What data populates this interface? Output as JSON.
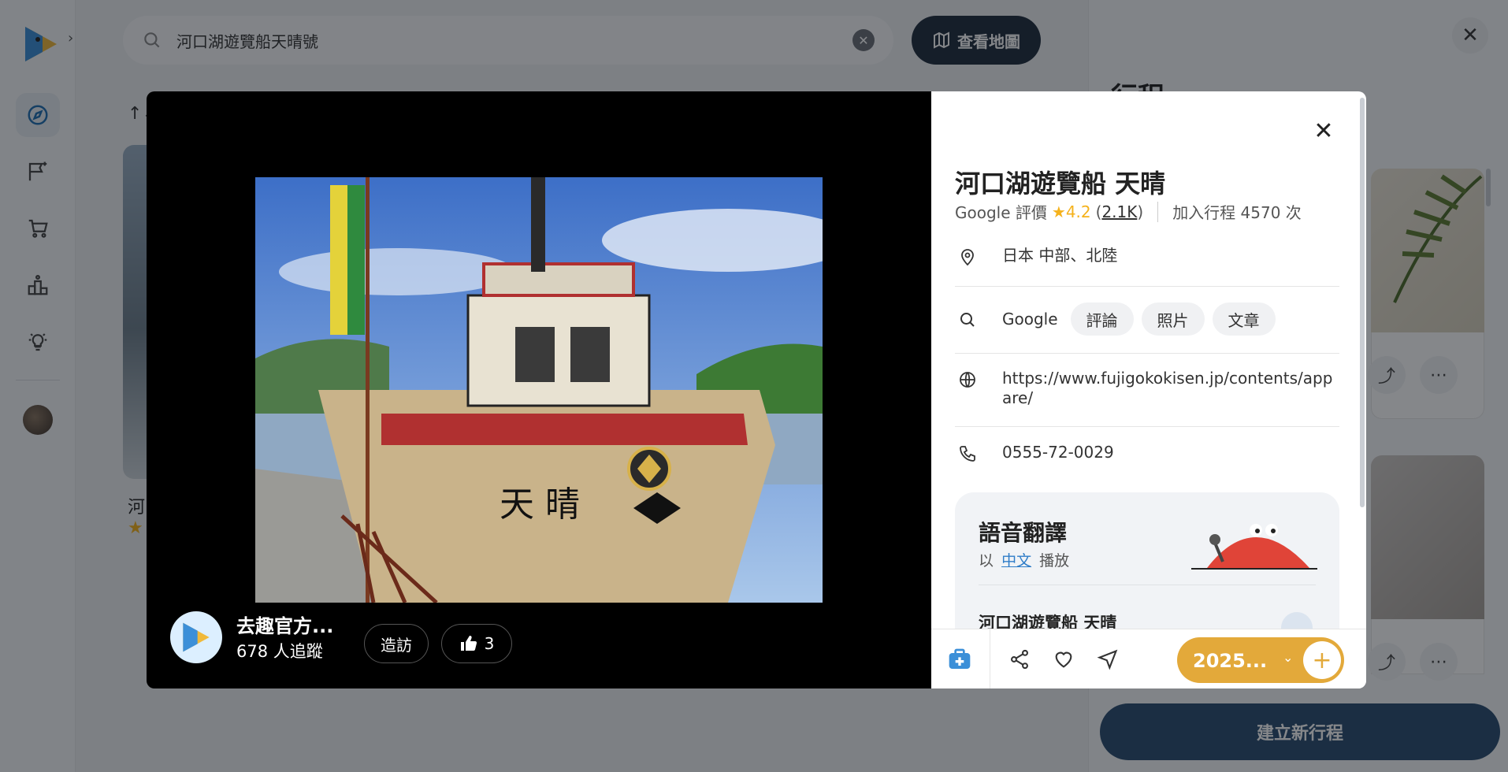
{
  "search": {
    "query": "河口湖遊覽船天晴號",
    "map_button": "查看地圖"
  },
  "background": {
    "card_title": "河",
    "card_star": "★"
  },
  "side_panel": {
    "title": "行程",
    "new_trip_button": "建立新行程"
  },
  "poi": {
    "title": "河口湖遊覽船 天晴",
    "rating_source": "Google 評價",
    "rating_star": "★",
    "rating": "4.2",
    "paren_open": "(",
    "review_count": "2.1K",
    "paren_close": ")",
    "added_to_trips": "加入行程 4570 次",
    "location": "日本 中部、北陸",
    "search_label": "Google",
    "search_chips": [
      "評論",
      "照片",
      "文章"
    ],
    "website": "https://www.fujigokokisen.jp/contents/appare/",
    "phone": "0555-72-0029"
  },
  "voice": {
    "title": "語音翻譯",
    "prefix": "以",
    "language": "中文",
    "suffix": "播放",
    "item_title": "河口湖遊覽船 天晴"
  },
  "author": {
    "name": "去趣官方...",
    "followers": "678 人追蹤"
  },
  "media_actions": {
    "visit": "造訪",
    "likes": "3"
  },
  "trip_selector": {
    "label": "2025..."
  },
  "icons": [
    "search-icon",
    "clear-icon",
    "map-icon",
    "compass-icon",
    "flag-icon",
    "cart-icon",
    "ranking-icon",
    "bulb-icon",
    "close-icon",
    "location-pin-icon",
    "globe-icon",
    "phone-icon",
    "thumbs-up-icon",
    "first-aid-icon",
    "share-icon",
    "heart-icon",
    "navigate-icon",
    "chevron-down-icon",
    "plus-icon",
    "speaker-icon",
    "more-icon",
    "sort-icon"
  ],
  "colors": {
    "accent": "#e3a93a",
    "navy": "#1f2c3d",
    "link": "#2f7dc8",
    "star": "#f5b21c"
  }
}
